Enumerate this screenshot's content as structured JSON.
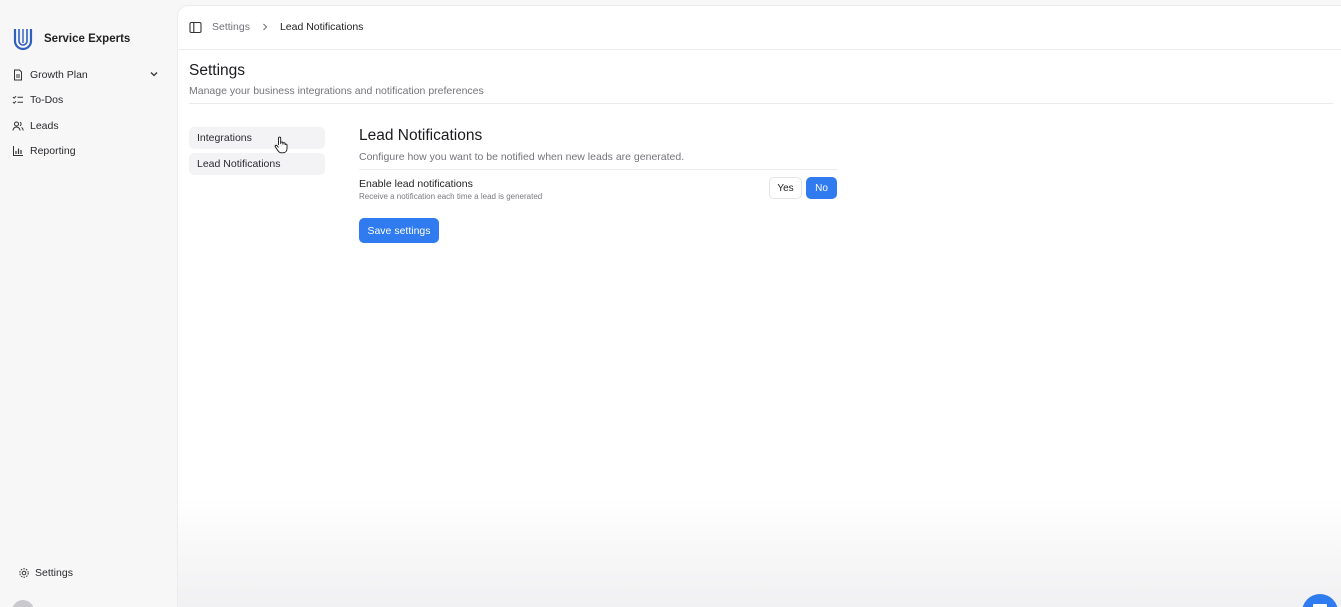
{
  "brand": {
    "name": "Service Experts"
  },
  "sidebar": {
    "items": [
      {
        "label": "Growth Plan",
        "icon": "document-icon",
        "has_chevron": true
      },
      {
        "label": "To-Dos",
        "icon": "checklist-icon"
      },
      {
        "label": "Leads",
        "icon": "users-icon"
      },
      {
        "label": "Reporting",
        "icon": "bar-chart-icon"
      }
    ],
    "footer": {
      "label": "Settings",
      "icon": "gear-icon"
    }
  },
  "breadcrumb": {
    "parent": "Settings",
    "current": "Lead Notifications"
  },
  "page": {
    "title": "Settings",
    "subtitle": "Manage your business integrations and notification preferences"
  },
  "subnav": {
    "items": [
      "Integrations",
      "Lead Notifications"
    ]
  },
  "panel": {
    "title": "Lead Notifications",
    "subtitle": "Configure how you want to be notified when new leads are generated.",
    "setting": {
      "label": "Enable lead notifications",
      "help": "Receive a notification each time a lead is generated",
      "options": [
        "Yes",
        "No"
      ],
      "selected": "No"
    },
    "save_label": "Save settings"
  },
  "colors": {
    "accent": "#2f7bef",
    "sidebar_bg": "#f7f7f8",
    "main_bg": "#ffffff"
  }
}
